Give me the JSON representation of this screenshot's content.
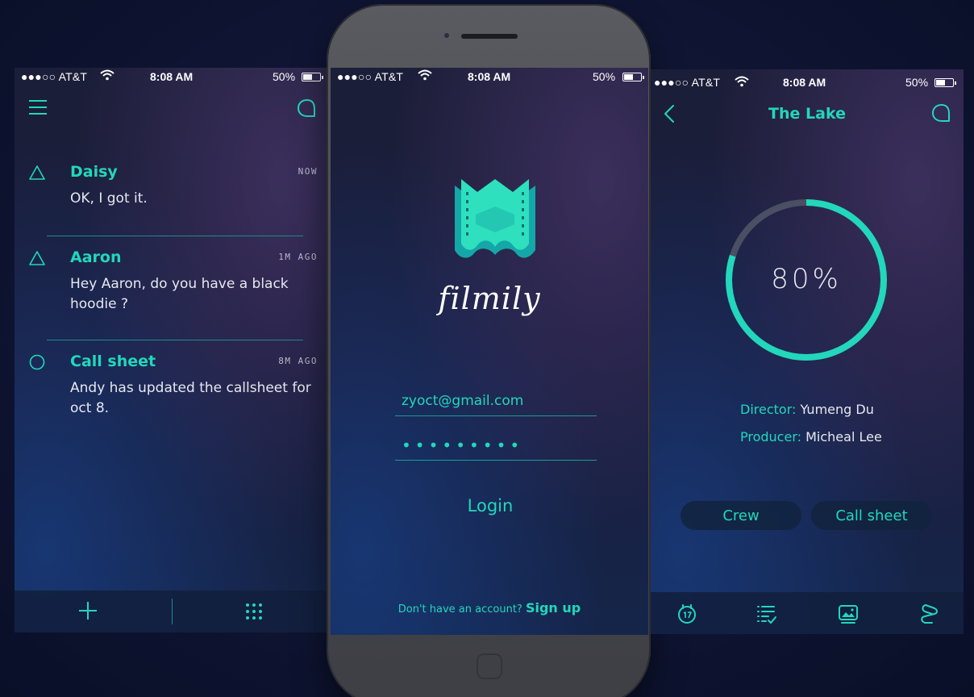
{
  "status_bar": {
    "carrier": "●●●○○ AT&T",
    "time": "8:08 AM",
    "battery": "50%"
  },
  "messages_screen": {
    "items": [
      {
        "name": "Daisy",
        "time": "NOW",
        "text": "OK, I got it.",
        "icon": "triangle-icon"
      },
      {
        "name": "Aaron",
        "time": "1M AGO",
        "text": "Hey Aaron, do you have a black hoodie ?",
        "icon": "triangle-icon"
      },
      {
        "name": "Call sheet",
        "time": "8M AGO",
        "text": "Andy has updated the callsheet for oct 8.",
        "icon": "circle-icon"
      }
    ]
  },
  "login_screen": {
    "brand": "filmily",
    "email_value": "zyoct@gmail.com",
    "password_value": "•••••••••",
    "login_label": "Login",
    "signup_prompt": "Don't have an account?",
    "signup_label": "Sign up"
  },
  "project_screen": {
    "title": "The Lake",
    "progress": 80,
    "progress_label": "80%",
    "director_label": "Director:",
    "director_name": "Yumeng Du",
    "producer_label": "Producer:",
    "producer_name": "Micheal Lee",
    "crew_label": "Crew",
    "callsheet_label": "Call sheet"
  },
  "colors": {
    "accent": "#22d7bb",
    "background": "#0f1533"
  }
}
